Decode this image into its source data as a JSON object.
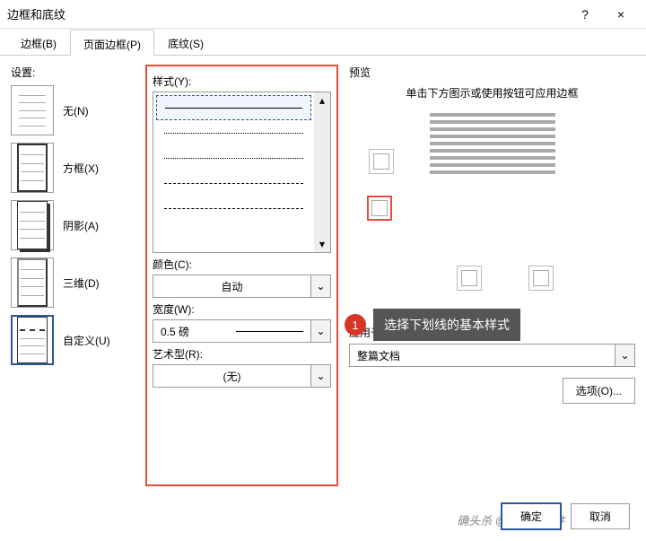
{
  "title": "边框和底纹",
  "help": "?",
  "close": "×",
  "tabs": {
    "border": "边框(B)",
    "page": "页面边框(P)",
    "shading": "底纹(S)"
  },
  "settings": {
    "label": "设置:",
    "none": "无(N)",
    "box": "方框(X)",
    "shadow": "阴影(A)",
    "threeD": "三维(D)",
    "custom": "自定义(U)"
  },
  "style": {
    "label": "样式(Y):"
  },
  "color": {
    "label": "颜色(C):",
    "value": "自动"
  },
  "width": {
    "label": "宽度(W):",
    "value": "0.5 磅"
  },
  "art": {
    "label": "艺术型(R):",
    "value": "(无)"
  },
  "preview": {
    "label": "预览",
    "hint": "单击下方图示或使用按钮可应用边框"
  },
  "applyTo": {
    "label": "应用于(L):",
    "value": "整篇文档"
  },
  "options": "选项(O)...",
  "callout": {
    "num": "1",
    "text": "选择下划线的基本样式"
  },
  "ok": "确定",
  "cancel": "取消",
  "watermark": "确头杀 @数据蛙软件"
}
